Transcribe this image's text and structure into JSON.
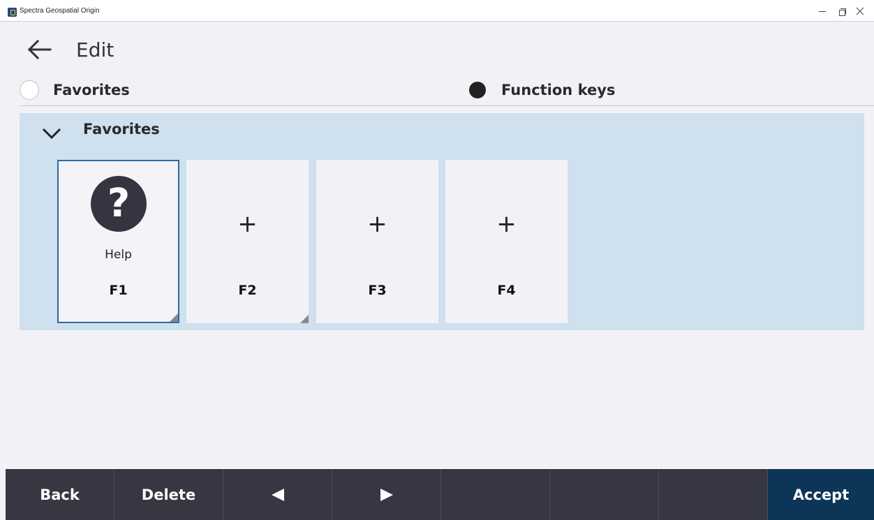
{
  "window": {
    "title": "Spectra Geospatial Origin",
    "icons": {
      "app": "app-logo-icon",
      "minimize": "minimize-icon",
      "restore": "restore-icon",
      "close": "close-icon"
    }
  },
  "header": {
    "title": "Edit",
    "back_icon": "arrow-left-icon"
  },
  "mode": {
    "options": [
      {
        "label": "Favorites",
        "selected": false
      },
      {
        "label": "Function keys",
        "selected": true
      }
    ]
  },
  "panel": {
    "title": "Favorites",
    "expanded": true,
    "keys": [
      {
        "label": "F1",
        "action": "Help",
        "icon": "help-icon",
        "selected": true,
        "has_corner": true
      },
      {
        "label": "F2",
        "action": "",
        "icon": "plus-icon",
        "selected": false,
        "has_corner": true
      },
      {
        "label": "F3",
        "action": "",
        "icon": "plus-icon",
        "selected": false,
        "has_corner": false
      },
      {
        "label": "F4",
        "action": "",
        "icon": "plus-icon",
        "selected": false,
        "has_corner": false
      }
    ],
    "plus_glyph": "+",
    "help_glyph": "?"
  },
  "toolbar": {
    "back_label": "Back",
    "delete_label": "Delete",
    "prev_icon": "triangle-left-icon",
    "next_icon": "triangle-right-icon",
    "accept_label": "Accept"
  },
  "colors": {
    "panel_bg": "#cfe0ee",
    "toolbar_bg": "#363743",
    "accept_bg": "#0c3558",
    "selected_border": "#2b6aa3"
  }
}
